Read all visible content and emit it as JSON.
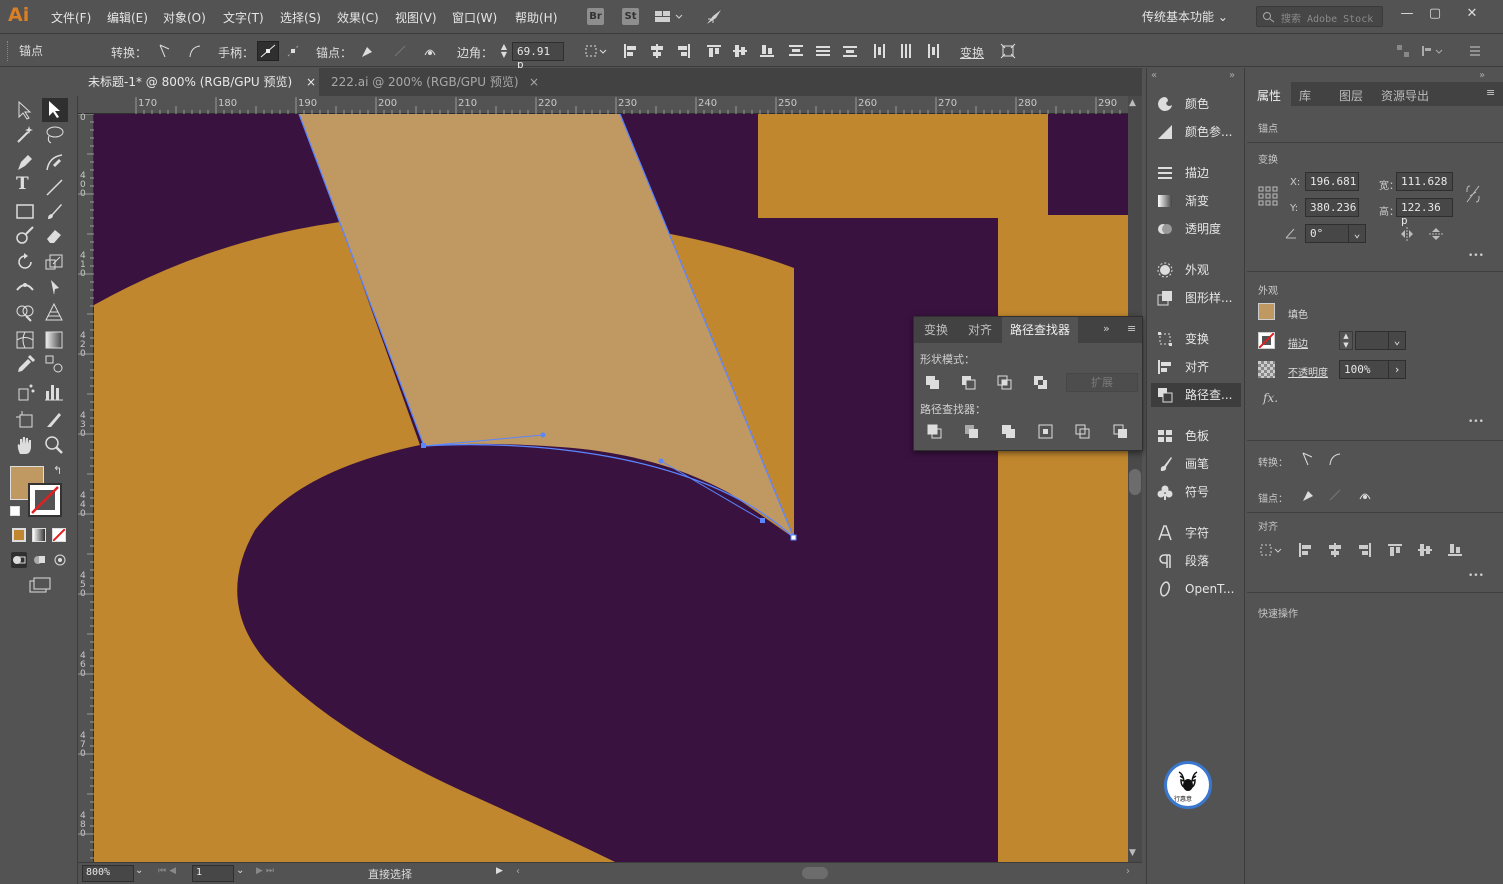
{
  "app": {
    "logo": "Ai"
  },
  "menu": [
    "文件(F)",
    "编辑(E)",
    "对象(O)",
    "文字(T)",
    "选择(S)",
    "效果(C)",
    "视图(V)",
    "窗口(W)",
    "帮助(H)"
  ],
  "menu_buttons": {
    "br": "Br",
    "st": "St"
  },
  "workspace": {
    "label": "传统基本功能",
    "search_placeholder": "搜索 Adobe Stock"
  },
  "control": {
    "anchor_label": "锚点",
    "convert_label": "转换：",
    "handle_label": "手柄：",
    "anchor_pt_label": "锚点：",
    "corner_label": "边角：",
    "corner_value": "69.91 p",
    "transform_label": "变换"
  },
  "tabs": [
    {
      "label": "未标题-1* @ 800% (RGB/GPU 预览)",
      "close": "×"
    },
    {
      "label": "222.ai @ 200% (RGB/GPU 预览)",
      "close": "×"
    }
  ],
  "ruler": {
    "h": [
      "170",
      "180",
      "190",
      "200",
      "210",
      "220",
      "230",
      "240",
      "250",
      "260",
      "270",
      "280",
      "290"
    ],
    "v": [
      "0",
      "400",
      "410",
      "420",
      "430",
      "440",
      "450",
      "460",
      "470",
      "480"
    ]
  },
  "status": {
    "zoom": "800%",
    "artboard": "1",
    "tool": "直接选择"
  },
  "pathfinder": {
    "tabs": [
      "变换",
      "对齐",
      "路径查找器"
    ],
    "shape_modes_label": "形状模式：",
    "expand_label": "扩展",
    "pathfinders_label": "路径查找器："
  },
  "dock": [
    "颜色",
    "颜色参...",
    "描边",
    "渐变",
    "透明度",
    "外观",
    "图形样...",
    "变换",
    "对齐",
    "路径查...",
    "色板",
    "画笔",
    "符号",
    "字符",
    "段落",
    "OpenT..."
  ],
  "props": {
    "tabs": [
      "属性",
      "库",
      "图层",
      "资源导出"
    ],
    "anchor_title": "锚点",
    "transform_title": "变换",
    "x_label": "X:",
    "x": "196.681",
    "y_label": "Y:",
    "y": "380.236",
    "w_label": "宽：",
    "w": "111.628",
    "h_label": "高：",
    "h": "122.36 p",
    "angle": "0°",
    "appearance_title": "外观",
    "fill_label": "填色",
    "stroke_label": "描边",
    "opacity_label": "不透明度",
    "opacity": "100%",
    "fx": "fx.",
    "convert_label": "转换：",
    "anchor_label": "锚点：",
    "align_title": "对齐",
    "quick_title": "快速操作",
    "more": "•••"
  },
  "watermark": {
    "text": "行惠意"
  },
  "colors": {
    "purple": "#3a1240",
    "orange": "#c1872e",
    "tan": "#c09862",
    "path": "#5b86ff"
  }
}
